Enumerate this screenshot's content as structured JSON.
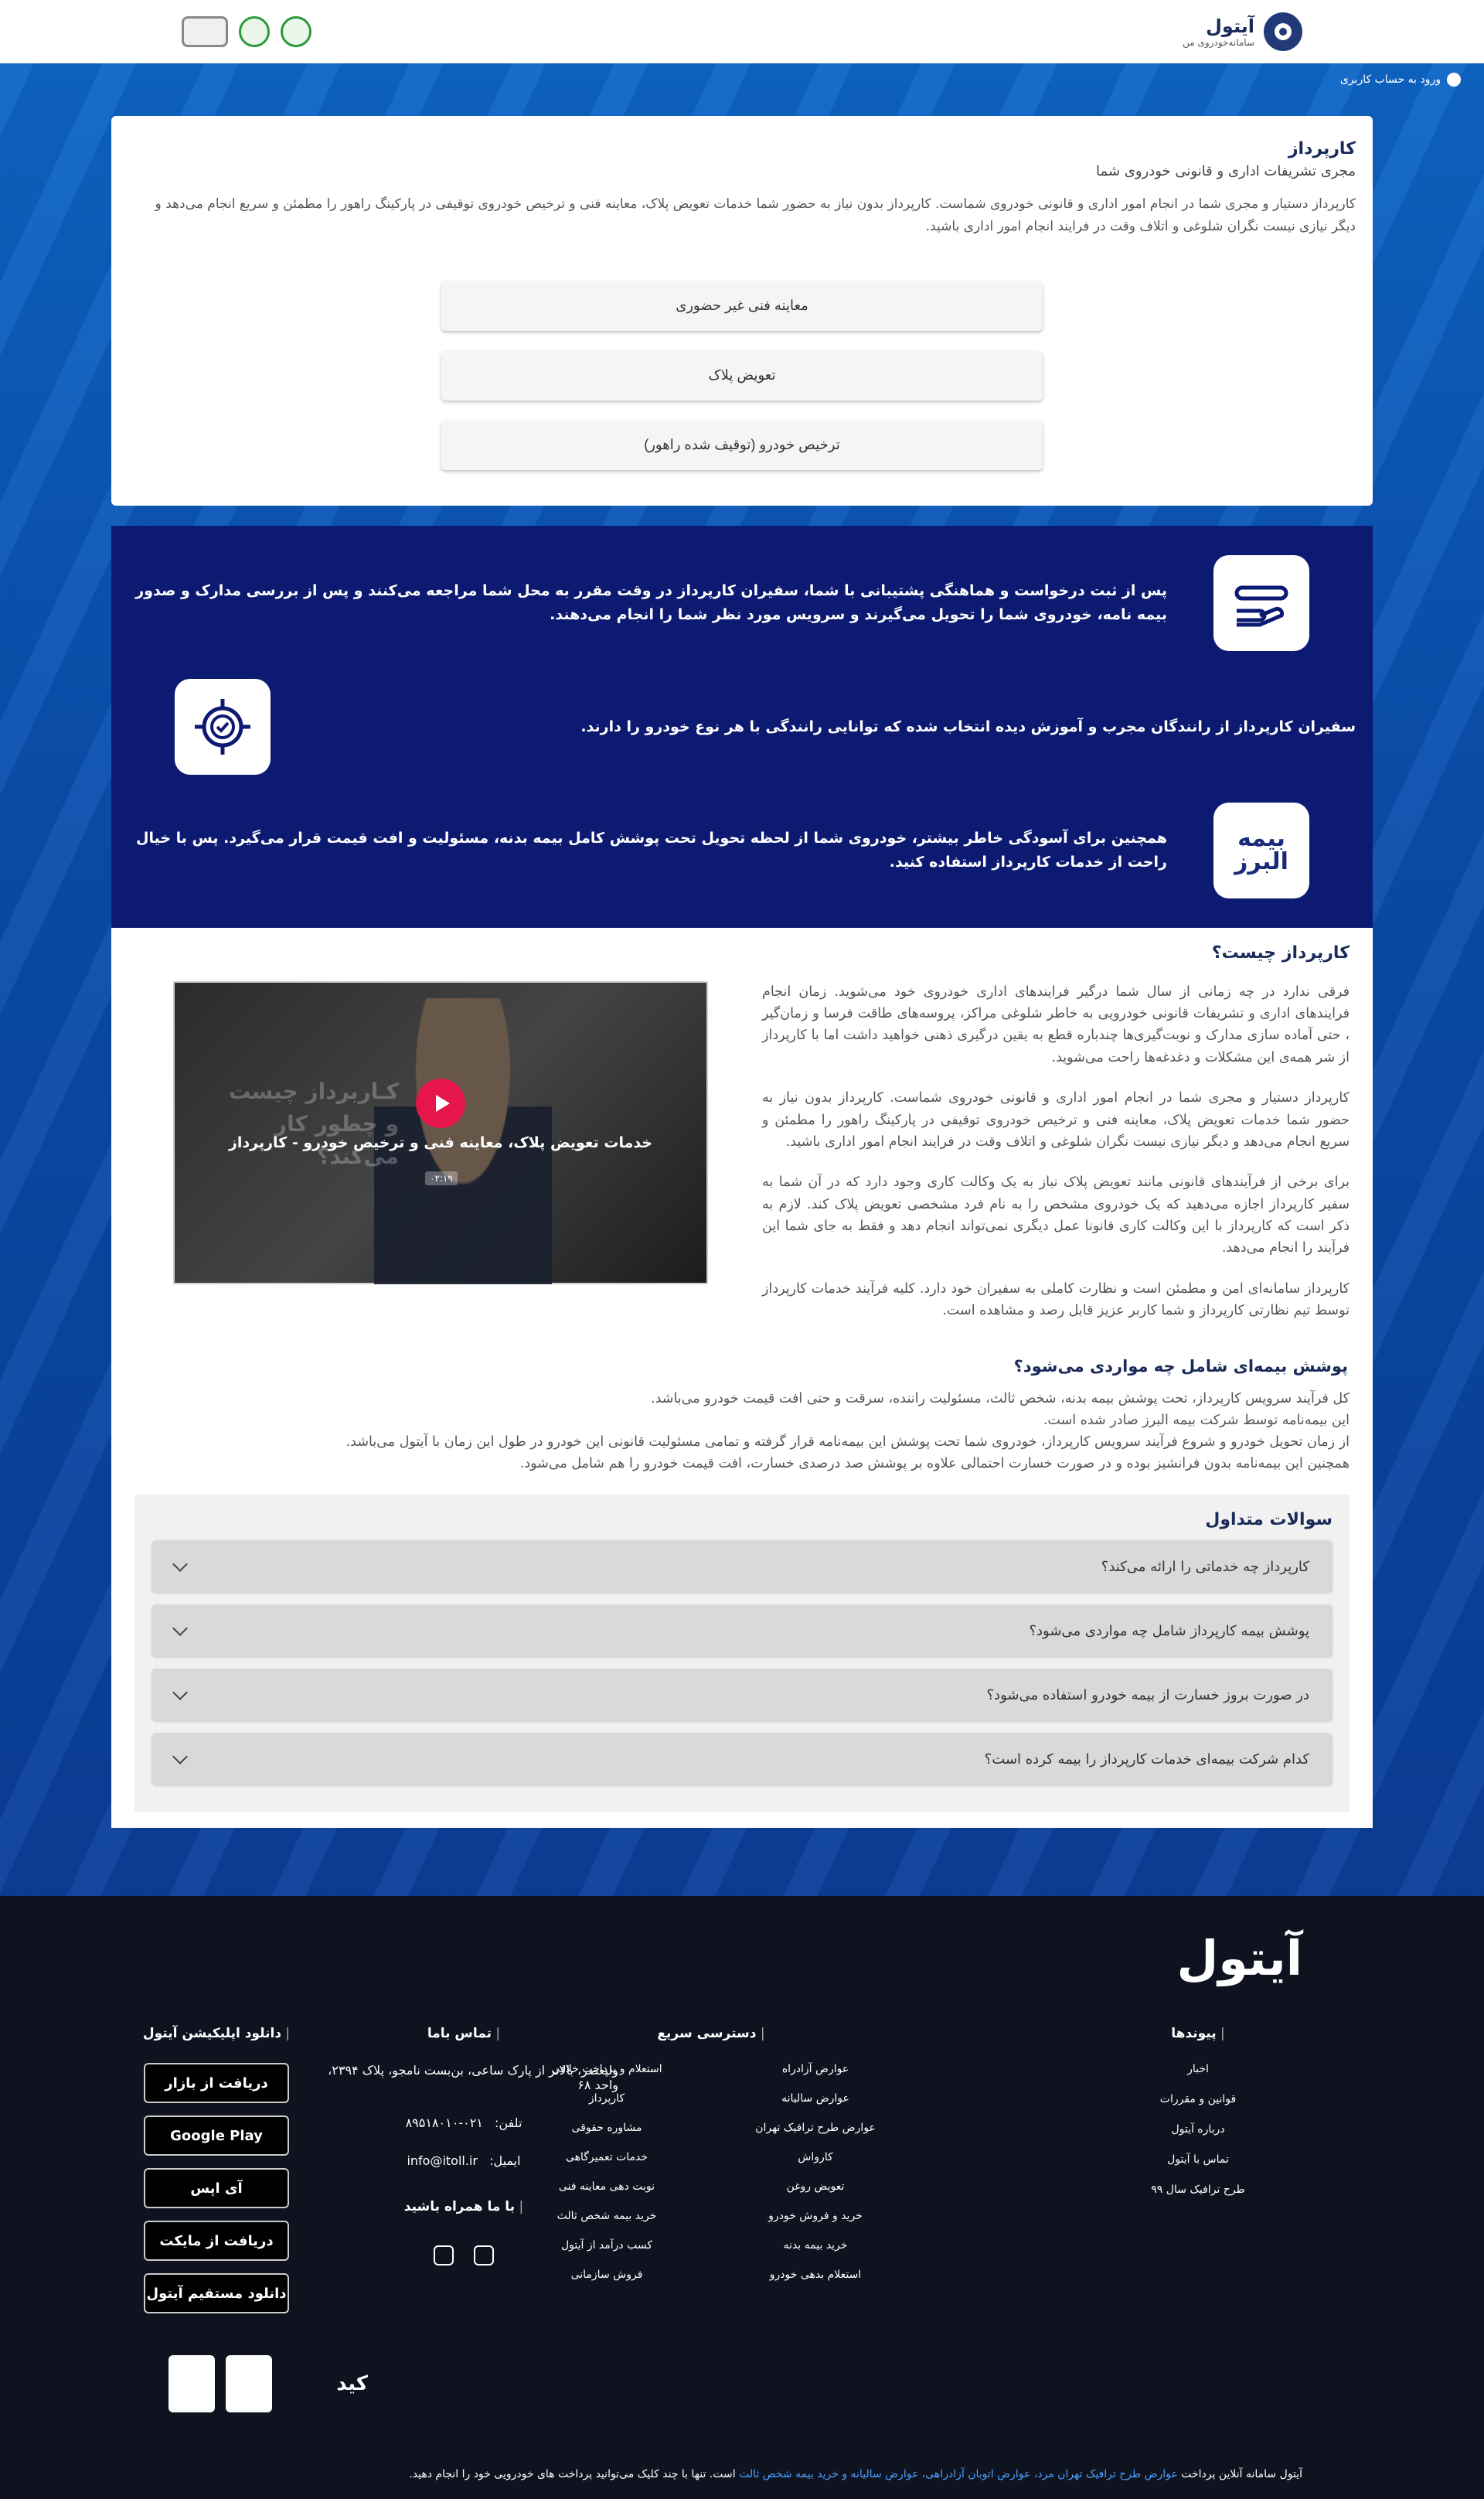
{
  "header": {
    "brand_name": "آیتول",
    "brand_sub": "سامانه‌خودروی من",
    "user_login": "ورود به حساب کاربری"
  },
  "card": {
    "title": "کارپرداز",
    "subtitle": "مجری تشریفات اداری و قانونی خودروی شما",
    "description": "کارپرداز دستیار و مجری شما در انجام امور اداری و قانونی خودروی شماست. کارپرداز بدون نیاز به حضور شما خدمات تعویض پلاک، معاینه فنی و ترخیص خودروی توقیفی در پارکینگ راهور را مطمئن و سریع انجام می‌دهد و دیگر نیازی نیست نگران شلوغی و اتلاف وقت در فرایند انجام امور اداری باشید.",
    "options": [
      "معاینه فنی غیر حضوری",
      "تعویض پلاک",
      "ترخیص خودرو (توقیف شده راهور)"
    ]
  },
  "features": [
    "پس از ثبت درخواست و هماهنگی پشتیبانی با شما، سفیران کارپرداز در وقت مقرر به محل شما مراجعه می‌کنند و پس از بررسی مدارک و صدور بیمه نامه، خودروی شما را تحویل می‌گیرند و سرویس مورد نظر شما را انجام می‌دهند.",
    "سفیران کارپرداز از رانندگان مجرب و آموزش دیده انتخاب شده که توانایی رانندگی با هر نوع خودرو را دارند.",
    "همچنین برای آسودگی خاطر بیشتر، خودروی شما از لحظه تحویل تحت پوشش کامل بیمه بدنه، مسئولیت و افت قیمت قرار می‌گیرد. پس با خیال راحت از خدمات کارپرداز استفاده کنید."
  ],
  "alborz_logo": "بیمه البرز",
  "what": {
    "title": "کارپرداز چیست؟",
    "paragraphs": [
      "فرقی ندارد در چه زمانی از سال شما درگیر فرایندهای اداری خودروی خود می‌شوید. زمان انجام فرایندهای اداری و تشریفات قانونی خودرویی به خاطر شلوغی مراکز، پروسه‌های طاقت فرسا و زمان‌گیر ، حتی آماده سازی مدارک و نوبت‌گیری‌ها چندباره قطع به یقین درگیری ذهنی خواهید داشت اما با کارپرداز از شر همه‌ی این مشکلات و دغدغه‌ها راحت می‌شوید.",
      "کارپرداز دستیار و مجری شما در انجام امور اداری و قانونی خودروی شماست. کارپرداز بدون نیاز به حضور شما خدمات تعویض پلاک، معاینه فنی و ترخیص خودروی توقیفی در پارکینگ راهور را مطمئن و سریع انجام می‌دهد و دیگر نیازی نیست نگران شلوغی و اتلاف وقت در فرایند انجام امور اداری باشید.",
      "برای برخی از فرآیندهای قانونی مانند تعویض پلاک نیاز به یک وکالت کاری وجود دارد که در آن شما به سفیر کارپرداز اجازه می‌دهید که یک خودروی مشخص را به نام فرد مشخصی تعویض پلاک کند. لازم به ذکر است که کارپرداز با این وکالت کاری قانونا عمل دیگری نمی‌تواند انجام دهد و فقط به جای شما این فرآیند را انجام می‌دهد.",
      "کارپرداز سامانه‌ای امن و مطمئن است و نظارت کاملی به سفیران خود دارد. کلیه فرآیند خدمات کارپرداز توسط تیم نظارتی کارپرداز و شما کاربر عزیز قابل رصد و مشاهده است."
    ],
    "video_title": "خدمات تعویض پلاک، معاینه فنی و ترخیص خودرو - کارپرداز",
    "video_faded": "کـاربرداز چیست و چطور کار می‌کند؟",
    "video_time": "۰۲:۱۹"
  },
  "cover": {
    "title": "پوشش بیمه‌ای شامل چه مواردی می‌شود؟",
    "lines": [
      "کل فرآیند سرویس کارپرداز، تحت پوشش بیمه بدنه، شخص ثالث، مسئولیت راننده، سرقت و حتی افت قیمت خودرو می‌باشد.",
      "این بیمه‌نامه توسط شرکت بیمه البرز صادر شده است.",
      "از زمان تحویل خودرو و شروع فرآیند سرویس کارپرداز، خودروی شما تحت پوشش این بیمه‌نامه قرار گرفته و تمامی مسئولیت قانونی این خودرو در طول این زمان با آیتول می‌باشد.",
      "همچنین این بیمه‌نامه بدون فرانشیز بوده و در صورت خسارت احتمالی علاوه بر پوشش صد درصدی خسارت، افت قیمت خودرو را هم شامل می‌شود."
    ]
  },
  "faq": {
    "title": "سوالات متداول",
    "items": [
      "کارپرداز چه خدماتی را ارائه می‌کند؟",
      "پوشش بیمه کارپرداز شامل چه مواردی می‌شود؟",
      "در صورت بروز خسارت از بیمه خودرو استفاده می‌شود؟",
      "کدام شرکت بیمه‌ای خدمات کارپرداز را بیمه کرده است؟"
    ]
  },
  "footer": {
    "logo": "آیتول",
    "links_title": "پیوندها",
    "links": [
      "اخبار",
      "قوانین و مقررات",
      "درباره آیتول",
      "تماس با آیتول",
      "طرح ترافیک سال ۹۹"
    ],
    "quick_title": "دسترسی سریع",
    "quick": [
      "عوارض آزادراه",
      "استعلام و پرداخت خلافی",
      "عوارض سالیانه",
      "کارپرداز",
      "عوارض طرح ترافیک تهران",
      "مشاوره حقوقی",
      "کارواش",
      "خدمات تعمیرگاهی",
      "تعویض روغن",
      "نوبت دهی معاینه فنی",
      "خرید و فروش خودرو",
      "خرید بیمه شخص ثالث",
      "خرید بیمه بدنه",
      "کسب درآمد از آیتول",
      "استعلام بدهی خودرو",
      "فروش سازمانی"
    ],
    "contact_title": "تماس باما",
    "address": "ولیعصر، بالاتر از پارک ساعی، بن‌بست نامجو، پلاک ۲۳۹۴، واحد ۶۸",
    "phone_label": "تلفن:",
    "phone": "۰۲۱-۸۹۵۱۸۰۱۰",
    "email_label": "ایمیل:",
    "email": "info@itoll.ir",
    "social_title": "با ما همراه باشید",
    "apps_title": "دانلود اپلیکیشن آیتول",
    "apps": [
      "دریافت از بازار",
      "Google Play",
      "آی اپس",
      "دریافت از مایکت",
      "دانلود مستقیم آیتول"
    ],
    "kid": "کید",
    "note_prefix": "آیتول سامانه آنلاین پرداخت",
    "note_links": "عوارض طرح ترافیک تهران مرد، عوارض اتوبان آزادراهی، عوارض سالیانه و خرید بیمه شخص ثالث",
    "note_suffix": "است. تنها با چند کلیک می‌توانید پرداخت های خودرویی خود را انجام دهید."
  },
  "colors": {
    "navy": "#0d1a72",
    "brand": "#1a2b5a",
    "play": "#e6164d"
  }
}
